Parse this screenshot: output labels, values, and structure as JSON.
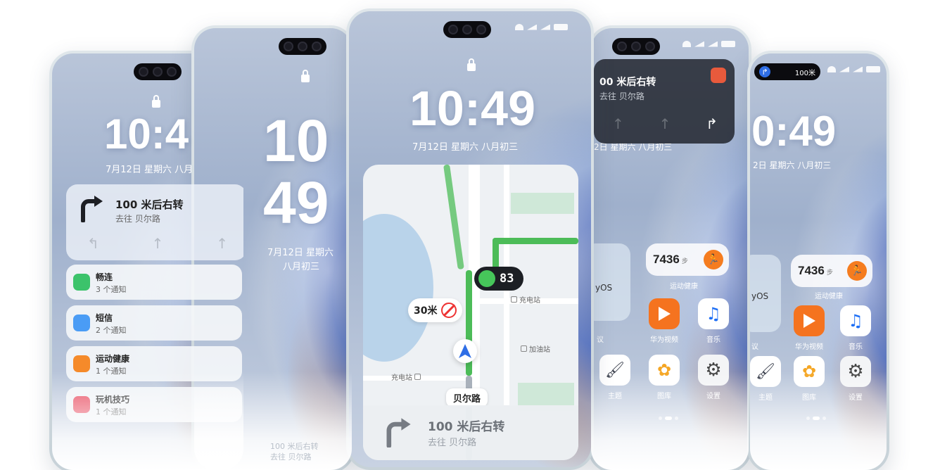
{
  "lockscreen": {
    "time": "10:49",
    "time_hours": "10",
    "time_minutes": "49",
    "time_partial_left": "10:4",
    "time_partial_right": "0:49",
    "date": "7月12日  星期六  八月初三",
    "date_partial_left": "7月12日  星期六  八月",
    "date_line1": "7月12日  星期六",
    "date_line2": "八月初三",
    "date_partial_right": "2日  星期六  八月初三",
    "date_partial_right2": "2日  星期六  八月初三"
  },
  "navigation": {
    "instruction": "100 米后右转",
    "instruction_partial": "00 米后右转",
    "destination": "去往 贝尔路",
    "destination_partial": "去往 贝尔路",
    "island_distance": "100米",
    "speed_limit": "30米",
    "traffic_countdown": "83",
    "road_name": "贝尔路",
    "poi_charging_1": "充电站",
    "poi_charging_2": "充电站",
    "poi_gas": "加油站"
  },
  "notifications": [
    {
      "app": "畅连",
      "count": "3 个通知",
      "color": "#3cc36b"
    },
    {
      "app": "短信",
      "count": "2 个通知",
      "color": "#4a9cf5"
    },
    {
      "app": "运动健康",
      "count": "1 个通知",
      "color": "#f58a2a"
    },
    {
      "app": "玩机技巧",
      "count": "1 个通知",
      "color": "#e84a5f"
    }
  ],
  "home": {
    "steps": "7436",
    "steps_unit": "步",
    "health_label": "运动健康",
    "harmony_text": "yOS",
    "harmony_label": "议",
    "apps": [
      {
        "label": "华为视频",
        "color": "#f5731f",
        "icon": "play-icon"
      },
      {
        "label": "音乐",
        "color": "#1e6ff5",
        "icon": "music-icon"
      },
      {
        "label": "主题",
        "color": "#2f3340",
        "icon": "brush-icon"
      },
      {
        "label": "图库",
        "color": "#ffffff",
        "icon": "gallery-icon"
      },
      {
        "label": "设置",
        "color": "#5a5e66",
        "icon": "gear-icon"
      }
    ]
  },
  "ghost": {
    "nav_reflection": "100 米后右转",
    "nav_reflection_sub": "去往 贝尔路"
  },
  "colors": {
    "route_green": "#4cbc58",
    "traffic_green": "#46c65a",
    "orange": "#f57c1f",
    "camera_red": "#e33333"
  }
}
